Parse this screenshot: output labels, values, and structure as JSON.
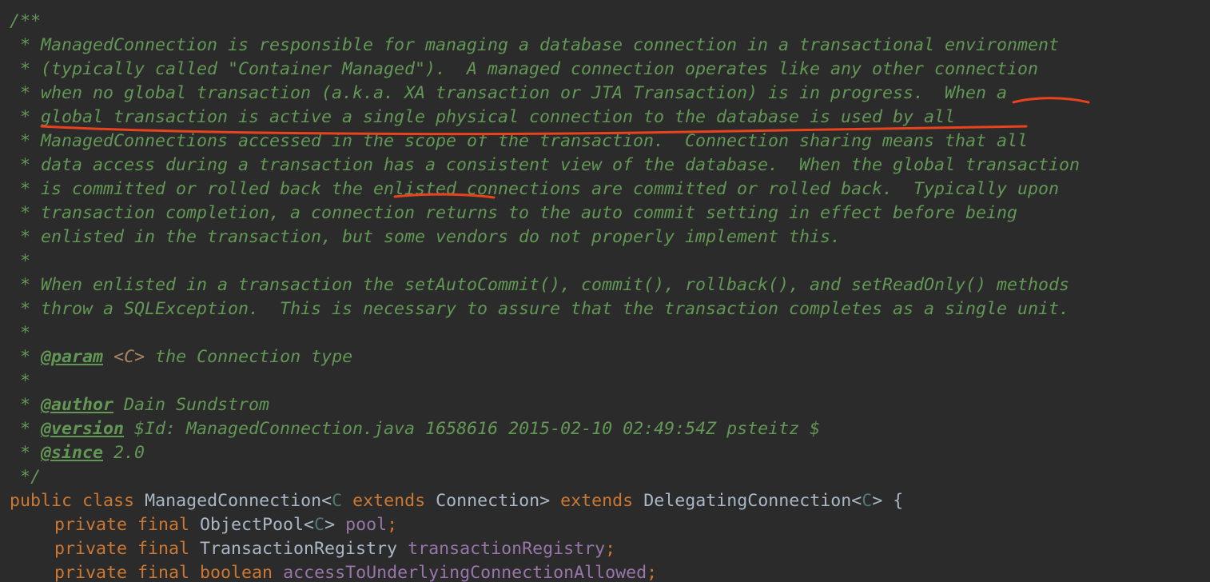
{
  "editor": {
    "lines": [
      "/**",
      " * ManagedConnection is responsible for managing a database connection in a transactional environment",
      " * (typically called \"Container Managed\").  A managed connection operates like any other connection",
      " * when no global transaction (a.k.a. XA transaction or JTA Transaction) is in progress.  When a",
      " * global transaction is active a single physical connection to the database is used by all",
      " * ManagedConnections accessed in the scope of the transaction.  Connection sharing means that all",
      " * data access during a transaction has a consistent view of the database.  When the global transaction",
      " * is committed or rolled back the enlisted connections are committed or rolled back.  Typically upon",
      " * transaction completion, a connection returns to the auto commit setting in effect before being",
      " * enlisted in the transaction, but some vendors do not properly implement this.",
      " *",
      " * When enlisted in a transaction the setAutoCommit(), commit(), rollback(), and setReadOnly() methods",
      " * throw a SQLException.  This is necessary to assure that the transaction completes as a single unit.",
      " *"
    ],
    "param_tag": "@param",
    "param_name": "<C>",
    "param_desc": " the Connection type",
    "blank_star": " *",
    "author_tag": "@author",
    "author_name": " Dain Sundstrom",
    "version_tag": "@version",
    "version_value": " $Id: ManagedConnection.java 1658616 2015-02-10 02:49:54Z psteitz $",
    "since_tag": "@since",
    "since_value": " 2.0",
    "comment_end": " */",
    "class_decl": {
      "kw_public": "public",
      "kw_class": "class",
      "class_name": "ManagedConnection<",
      "type_param": "C",
      "kw_extends1": "extends",
      "super_type": "Connection>",
      "kw_extends2": "extends",
      "parent_class": "DelegatingConnection<",
      "type_param2": "C",
      "close": "> {"
    },
    "fields": [
      {
        "mods": "private final",
        "type": "ObjectPool<",
        "tp": "C",
        "type_end": ">",
        "name": "pool",
        "end": ";"
      },
      {
        "mods": "private final",
        "type": "TransactionRegistry",
        "tp": "",
        "type_end": "",
        "name": "transactionRegistry",
        "end": ";"
      },
      {
        "mods": "private final",
        "type": "boolean",
        "tp": "",
        "type_end": "",
        "name": "accessToUnderlyingConnectionAllowed",
        "end": ";"
      }
    ]
  },
  "colors": {
    "background": "#2b2b2b",
    "doc_comment": "#629755",
    "keyword": "#cc7832",
    "field": "#9876aa",
    "annotation_pen": "#e8431c"
  }
}
